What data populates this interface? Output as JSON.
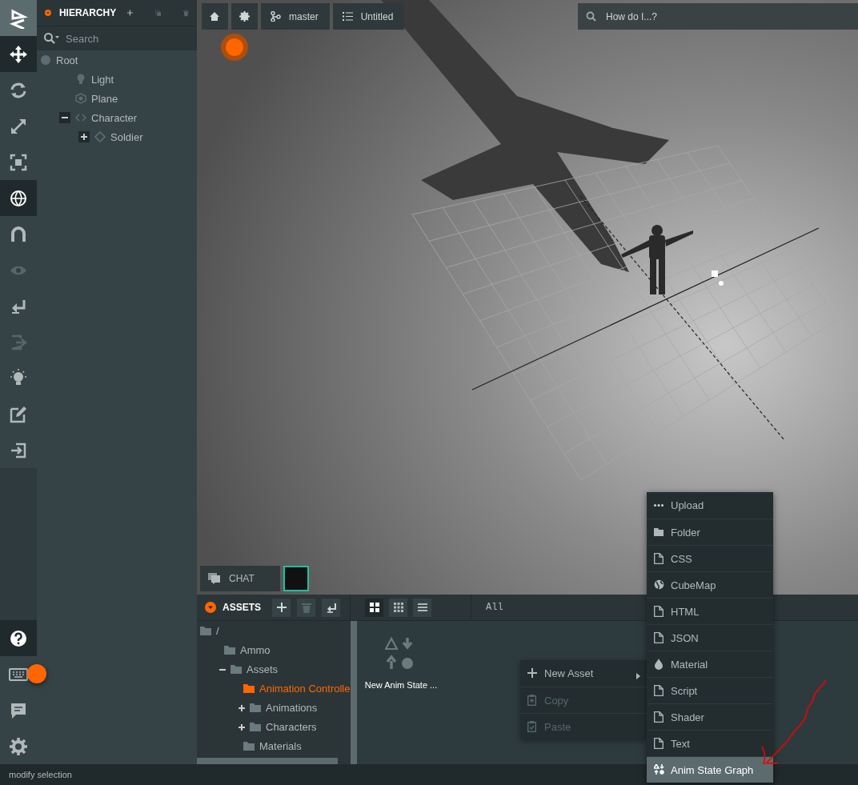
{
  "toolbar": {
    "tools": [
      {
        "selected": true,
        "disabled": false
      },
      {
        "selected": false,
        "disabled": false
      },
      {
        "selected": false,
        "disabled": false
      },
      {
        "selected": false,
        "disabled": false
      },
      {
        "selected": true,
        "disabled": false
      },
      {
        "selected": false,
        "disabled": false
      },
      {
        "selected": false,
        "disabled": true
      },
      {
        "selected": false,
        "disabled": false
      },
      {
        "selected": false,
        "disabled": true
      },
      {
        "selected": false,
        "disabled": false
      },
      {
        "selected": false,
        "disabled": false
      },
      {
        "selected": false,
        "disabled": false
      }
    ],
    "bottom_tools": [
      {
        "selected": true,
        "disabled": false
      },
      {
        "selected": false,
        "disabled": false
      },
      {
        "selected": false,
        "disabled": false
      },
      {
        "selected": false,
        "disabled": false
      }
    ]
  },
  "hierarchy": {
    "title": "HIERARCHY",
    "search": {
      "placeholder": "Search"
    },
    "items": [
      {
        "label": "Root",
        "kind": "root",
        "children": [
          {
            "label": "Light",
            "kind": "light"
          },
          {
            "label": "Plane",
            "kind": "plane"
          },
          {
            "label": "Character",
            "kind": "entity",
            "expanded": true,
            "children": [
              {
                "label": "Soldier",
                "kind": "model",
                "expanded": false
              }
            ]
          }
        ]
      }
    ]
  },
  "viewport": {
    "toolbar": [
      {
        "kind": "home"
      },
      {
        "kind": "settings"
      },
      {
        "kind": "branch",
        "label": "master"
      },
      {
        "kind": "list",
        "label": "Untitled"
      }
    ],
    "help_search": {
      "placeholder": "How do I...?"
    },
    "chat": {
      "label": "CHAT"
    }
  },
  "assets": {
    "title": "ASSETS",
    "actions": [
      {
        "kind": "add",
        "disabled": false
      },
      {
        "kind": "delete",
        "disabled": true
      },
      {
        "kind": "back",
        "disabled": false
      }
    ],
    "views": [
      {
        "kind": "large",
        "selected": true
      },
      {
        "kind": "small",
        "selected": false
      },
      {
        "kind": "list",
        "selected": false
      }
    ],
    "filter": {
      "value": "All"
    },
    "folders": [
      {
        "label": "/",
        "selected": false,
        "children": [
          {
            "label": "Ammo",
            "selected": false
          },
          {
            "label": "Assets",
            "expanded": true,
            "selected": false,
            "children": [
              {
                "label": "Animation Controlle",
                "selected": true
              },
              {
                "label": "Animations",
                "expanded": false,
                "selected": false
              },
              {
                "label": "Characters",
                "expanded": false,
                "selected": false
              },
              {
                "label": "Materials",
                "selected": false
              }
            ]
          }
        ]
      }
    ],
    "items": [
      {
        "label": "New Anim State ..."
      }
    ]
  },
  "context_menu": {
    "items": [
      {
        "label": "New Asset",
        "kind": "add",
        "disabled": false,
        "submenu": true
      },
      {
        "label": "Copy",
        "kind": "copy",
        "disabled": true,
        "submenu": false
      },
      {
        "label": "Paste",
        "kind": "paste",
        "disabled": true,
        "submenu": false
      }
    ]
  },
  "new_asset_menu": {
    "items": [
      {
        "label": "Upload",
        "kind": "dots",
        "selected": false
      },
      {
        "label": "Folder",
        "kind": "folder",
        "selected": false
      },
      {
        "label": "CSS",
        "kind": "file",
        "selected": false
      },
      {
        "label": "CubeMap",
        "kind": "globe",
        "selected": false
      },
      {
        "label": "HTML",
        "kind": "file",
        "selected": false
      },
      {
        "label": "JSON",
        "kind": "file",
        "selected": false
      },
      {
        "label": "Material",
        "kind": "drop",
        "selected": false
      },
      {
        "label": "Script",
        "kind": "file",
        "selected": false
      },
      {
        "label": "Shader",
        "kind": "file",
        "selected": false
      },
      {
        "label": "Text",
        "kind": "file",
        "selected": false
      },
      {
        "label": "Anim State Graph",
        "kind": "graph",
        "selected": true
      }
    ]
  },
  "status_bar": {
    "text": "modify selection"
  }
}
